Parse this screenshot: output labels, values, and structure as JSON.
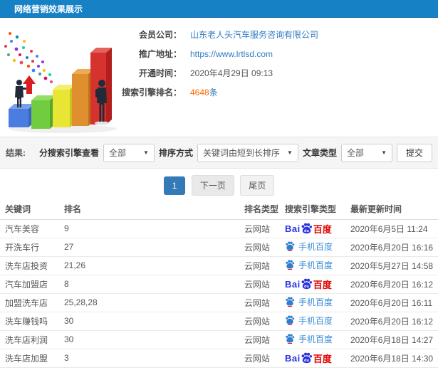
{
  "header": {
    "title": "网络营销效果展示"
  },
  "info": {
    "rows": [
      {
        "label": "会员公司：",
        "value": "山东老人头汽车服务咨询有限公司",
        "type": "link"
      },
      {
        "label": "推广地址：",
        "value": "https://www.lrtlsd.com",
        "type": "link"
      },
      {
        "label": "开通时间：",
        "value": "2020年4月29日 09:13",
        "type": "text"
      },
      {
        "label": "搜索引擎排名：",
        "value": "4648",
        "suffix": "条",
        "type": "highlight"
      }
    ]
  },
  "filters": {
    "result_label": "结果:",
    "engine_label": "分搜索引擎查看",
    "engine_value": "全部",
    "sort_label": "排序方式",
    "sort_value": "关键词由短到长排序",
    "article_label": "文章类型",
    "article_value": "全部",
    "submit_label": "提交"
  },
  "pagination": {
    "current": "1",
    "next": "下一页",
    "last": "尾页"
  },
  "table": {
    "headers": [
      "关键词",
      "排名",
      "排名类型",
      "搜索引擎类型",
      "最新更新时间"
    ],
    "engine_labels": {
      "baidu": {
        "prefix": "Bai",
        "paw_text": "du",
        "suffix": "百度"
      },
      "mobile_baidu": {
        "label": "手机百度"
      }
    },
    "rows": [
      {
        "keyword": "汽车美容",
        "rank": "9",
        "rank_type": "云网站",
        "engine": "baidu",
        "time": "2020年6月5日 11:24"
      },
      {
        "keyword": "开洗车行",
        "rank": "27",
        "rank_type": "云网站",
        "engine": "mobile_baidu",
        "time": "2020年6月20日 16:16"
      },
      {
        "keyword": "洗车店投资",
        "rank": "21,26",
        "rank_type": "云网站",
        "engine": "mobile_baidu",
        "time": "2020年5月27日 14:58"
      },
      {
        "keyword": "汽车加盟店",
        "rank": "8",
        "rank_type": "云网站",
        "engine": "baidu",
        "time": "2020年6月20日 16:12"
      },
      {
        "keyword": "加盟洗车店",
        "rank": "25,28,28",
        "rank_type": "云网站",
        "engine": "mobile_baidu",
        "time": "2020年6月20日 16:11"
      },
      {
        "keyword": "洗车赚钱吗",
        "rank": "30",
        "rank_type": "云网站",
        "engine": "mobile_baidu",
        "time": "2020年6月20日 16:12"
      },
      {
        "keyword": "洗车店利润",
        "rank": "30",
        "rank_type": "云网站",
        "engine": "mobile_baidu",
        "time": "2020年6月18日 14:27"
      },
      {
        "keyword": "洗车店加盟",
        "rank": "3",
        "rank_type": "云网站",
        "engine": "baidu",
        "time": "2020年6月18日 14:30"
      }
    ]
  },
  "colors": {
    "header_bg": "#1681c4",
    "link_blue": "#2f7cc3",
    "highlight_orange": "#ff6600",
    "active_page_bg": "#337ab7",
    "baidu_blue": "#2932e1",
    "baidu_red": "#e10602",
    "mobile_baidu_blue": "#3c8dd9"
  }
}
